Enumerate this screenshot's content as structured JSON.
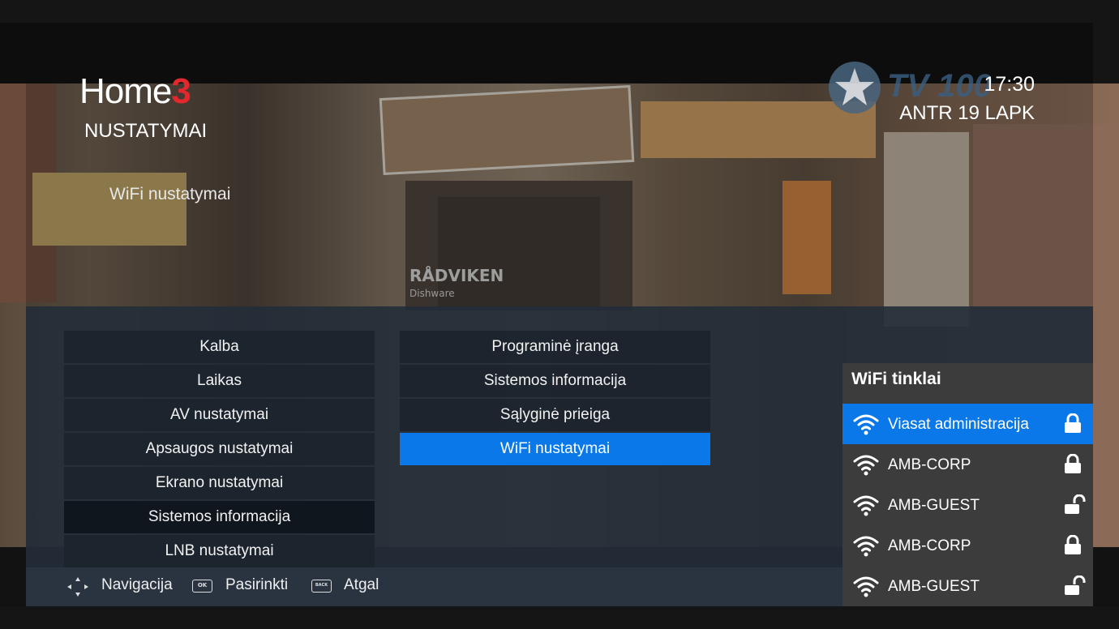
{
  "header": {
    "logo_text": "Home",
    "logo_number": "3",
    "section_title": "NUSTATYMAI",
    "current_item": "WiFi nustatymai",
    "channel_name": "TV 100",
    "time": "17:30",
    "date": "ANTR 19 LAPK"
  },
  "background": {
    "watermark": "RÅDVIKEN",
    "watermark_sub": "Dishware"
  },
  "menu": {
    "column1": [
      {
        "label": "Kalba",
        "state": "normal"
      },
      {
        "label": "Laikas",
        "state": "normal"
      },
      {
        "label": "AV nustatymai",
        "state": "normal"
      },
      {
        "label": "Apsaugos nustatymai",
        "state": "normal"
      },
      {
        "label": "Ekrano nustatymai",
        "state": "normal"
      },
      {
        "label": "Sistemos informacija",
        "state": "dark"
      },
      {
        "label": "LNB nustatymai",
        "state": "normal"
      }
    ],
    "column2": [
      {
        "label": "Programinė įranga",
        "state": "normal"
      },
      {
        "label": "Sistemos informacija",
        "state": "normal"
      },
      {
        "label": "Sąlyginė prieiga",
        "state": "normal"
      },
      {
        "label": "WiFi nustatymai",
        "state": "selected"
      }
    ]
  },
  "footer": {
    "nav_label": "Navigacija",
    "ok_key": "OK",
    "ok_label": "Pasirinkti",
    "back_key": "BACK",
    "back_label": "Atgal"
  },
  "wifi": {
    "title": "WiFi tinklai",
    "networks": [
      {
        "name": "Viasat administracija",
        "locked": true,
        "selected": true
      },
      {
        "name": "AMB-CORP",
        "locked": true,
        "selected": false
      },
      {
        "name": "AMB-GUEST",
        "locked": false,
        "selected": false
      },
      {
        "name": "AMB-CORP",
        "locked": true,
        "selected": false
      },
      {
        "name": "AMB-GUEST",
        "locked": false,
        "selected": false
      }
    ]
  },
  "colors": {
    "accent": "#0a78e8",
    "logo_red": "#e3282d"
  }
}
